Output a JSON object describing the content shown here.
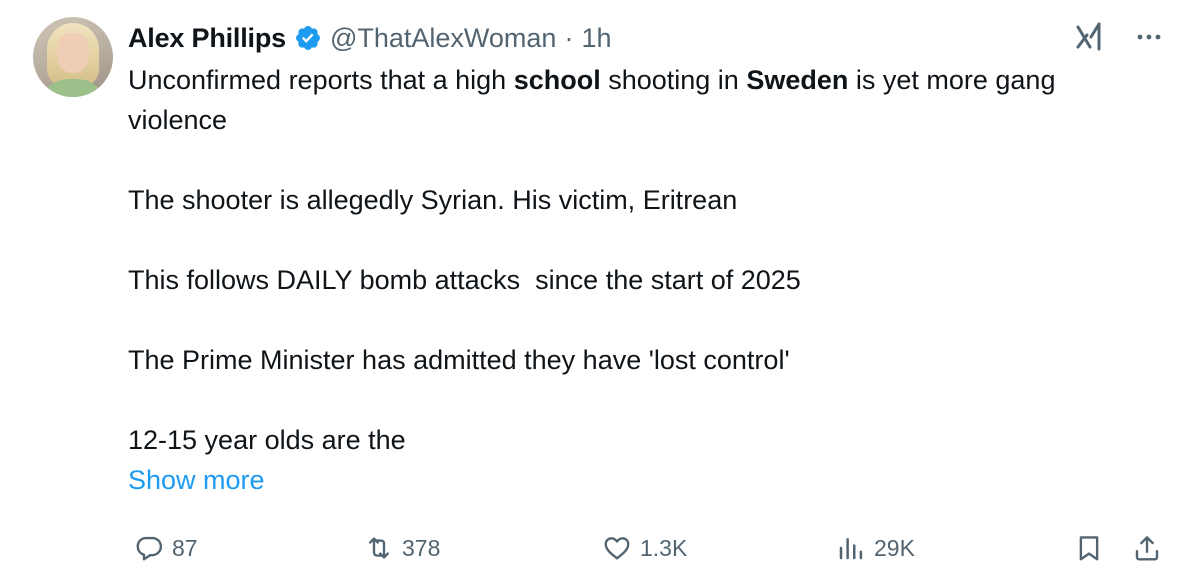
{
  "author": {
    "name": "Alex Phillips",
    "handle": "@ThatAlexWoman",
    "separator": "·",
    "time": "1h",
    "verified_color": "#1d9bf0"
  },
  "post": {
    "line1_part1": "Unconfirmed reports that a high ",
    "line1_bold1": "school",
    "line1_part2": " shooting in ",
    "line1_bold2": "Sweden",
    "line1_part3": " is yet more gang violence",
    "paragraph2": "The shooter is allegedly Syrian. His victim, Eritrean",
    "paragraph3": "This follows DAILY bomb attacks  since the start of 2025",
    "paragraph4": "The Prime Minister has admitted they have 'lost control'",
    "paragraph5": "12-15 year olds are the",
    "show_more": "Show more",
    "link_color": "#1d9bf0"
  },
  "actions": {
    "replies": "87",
    "reposts": "378",
    "likes": "1.3K",
    "views": "29K"
  },
  "icons": {
    "verified": "verified-badge-icon",
    "grok": "grok-icon",
    "more": "more-options-icon",
    "reply": "reply-icon",
    "repost": "repost-icon",
    "like": "heart-icon",
    "views": "views-chart-icon",
    "bookmark": "bookmark-icon",
    "share": "share-icon"
  }
}
